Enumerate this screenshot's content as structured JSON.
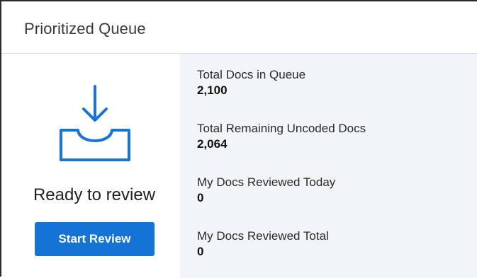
{
  "card": {
    "title": "Prioritized Queue"
  },
  "left_panel": {
    "icon": "inbox-download-icon",
    "status_text": "Ready to review",
    "start_button_label": "Start Review"
  },
  "stats": [
    {
      "label": "Total Docs in Queue",
      "value": "2,100"
    },
    {
      "label": "Total Remaining Uncoded Docs",
      "value": "2,064"
    },
    {
      "label": "My Docs Reviewed Today",
      "value": "0"
    },
    {
      "label": "My Docs Reviewed Total",
      "value": "0"
    }
  ],
  "colors": {
    "accent": "#1673d6",
    "stats_background": "#f1f5f9",
    "icon_stroke": "#1a74d3"
  }
}
